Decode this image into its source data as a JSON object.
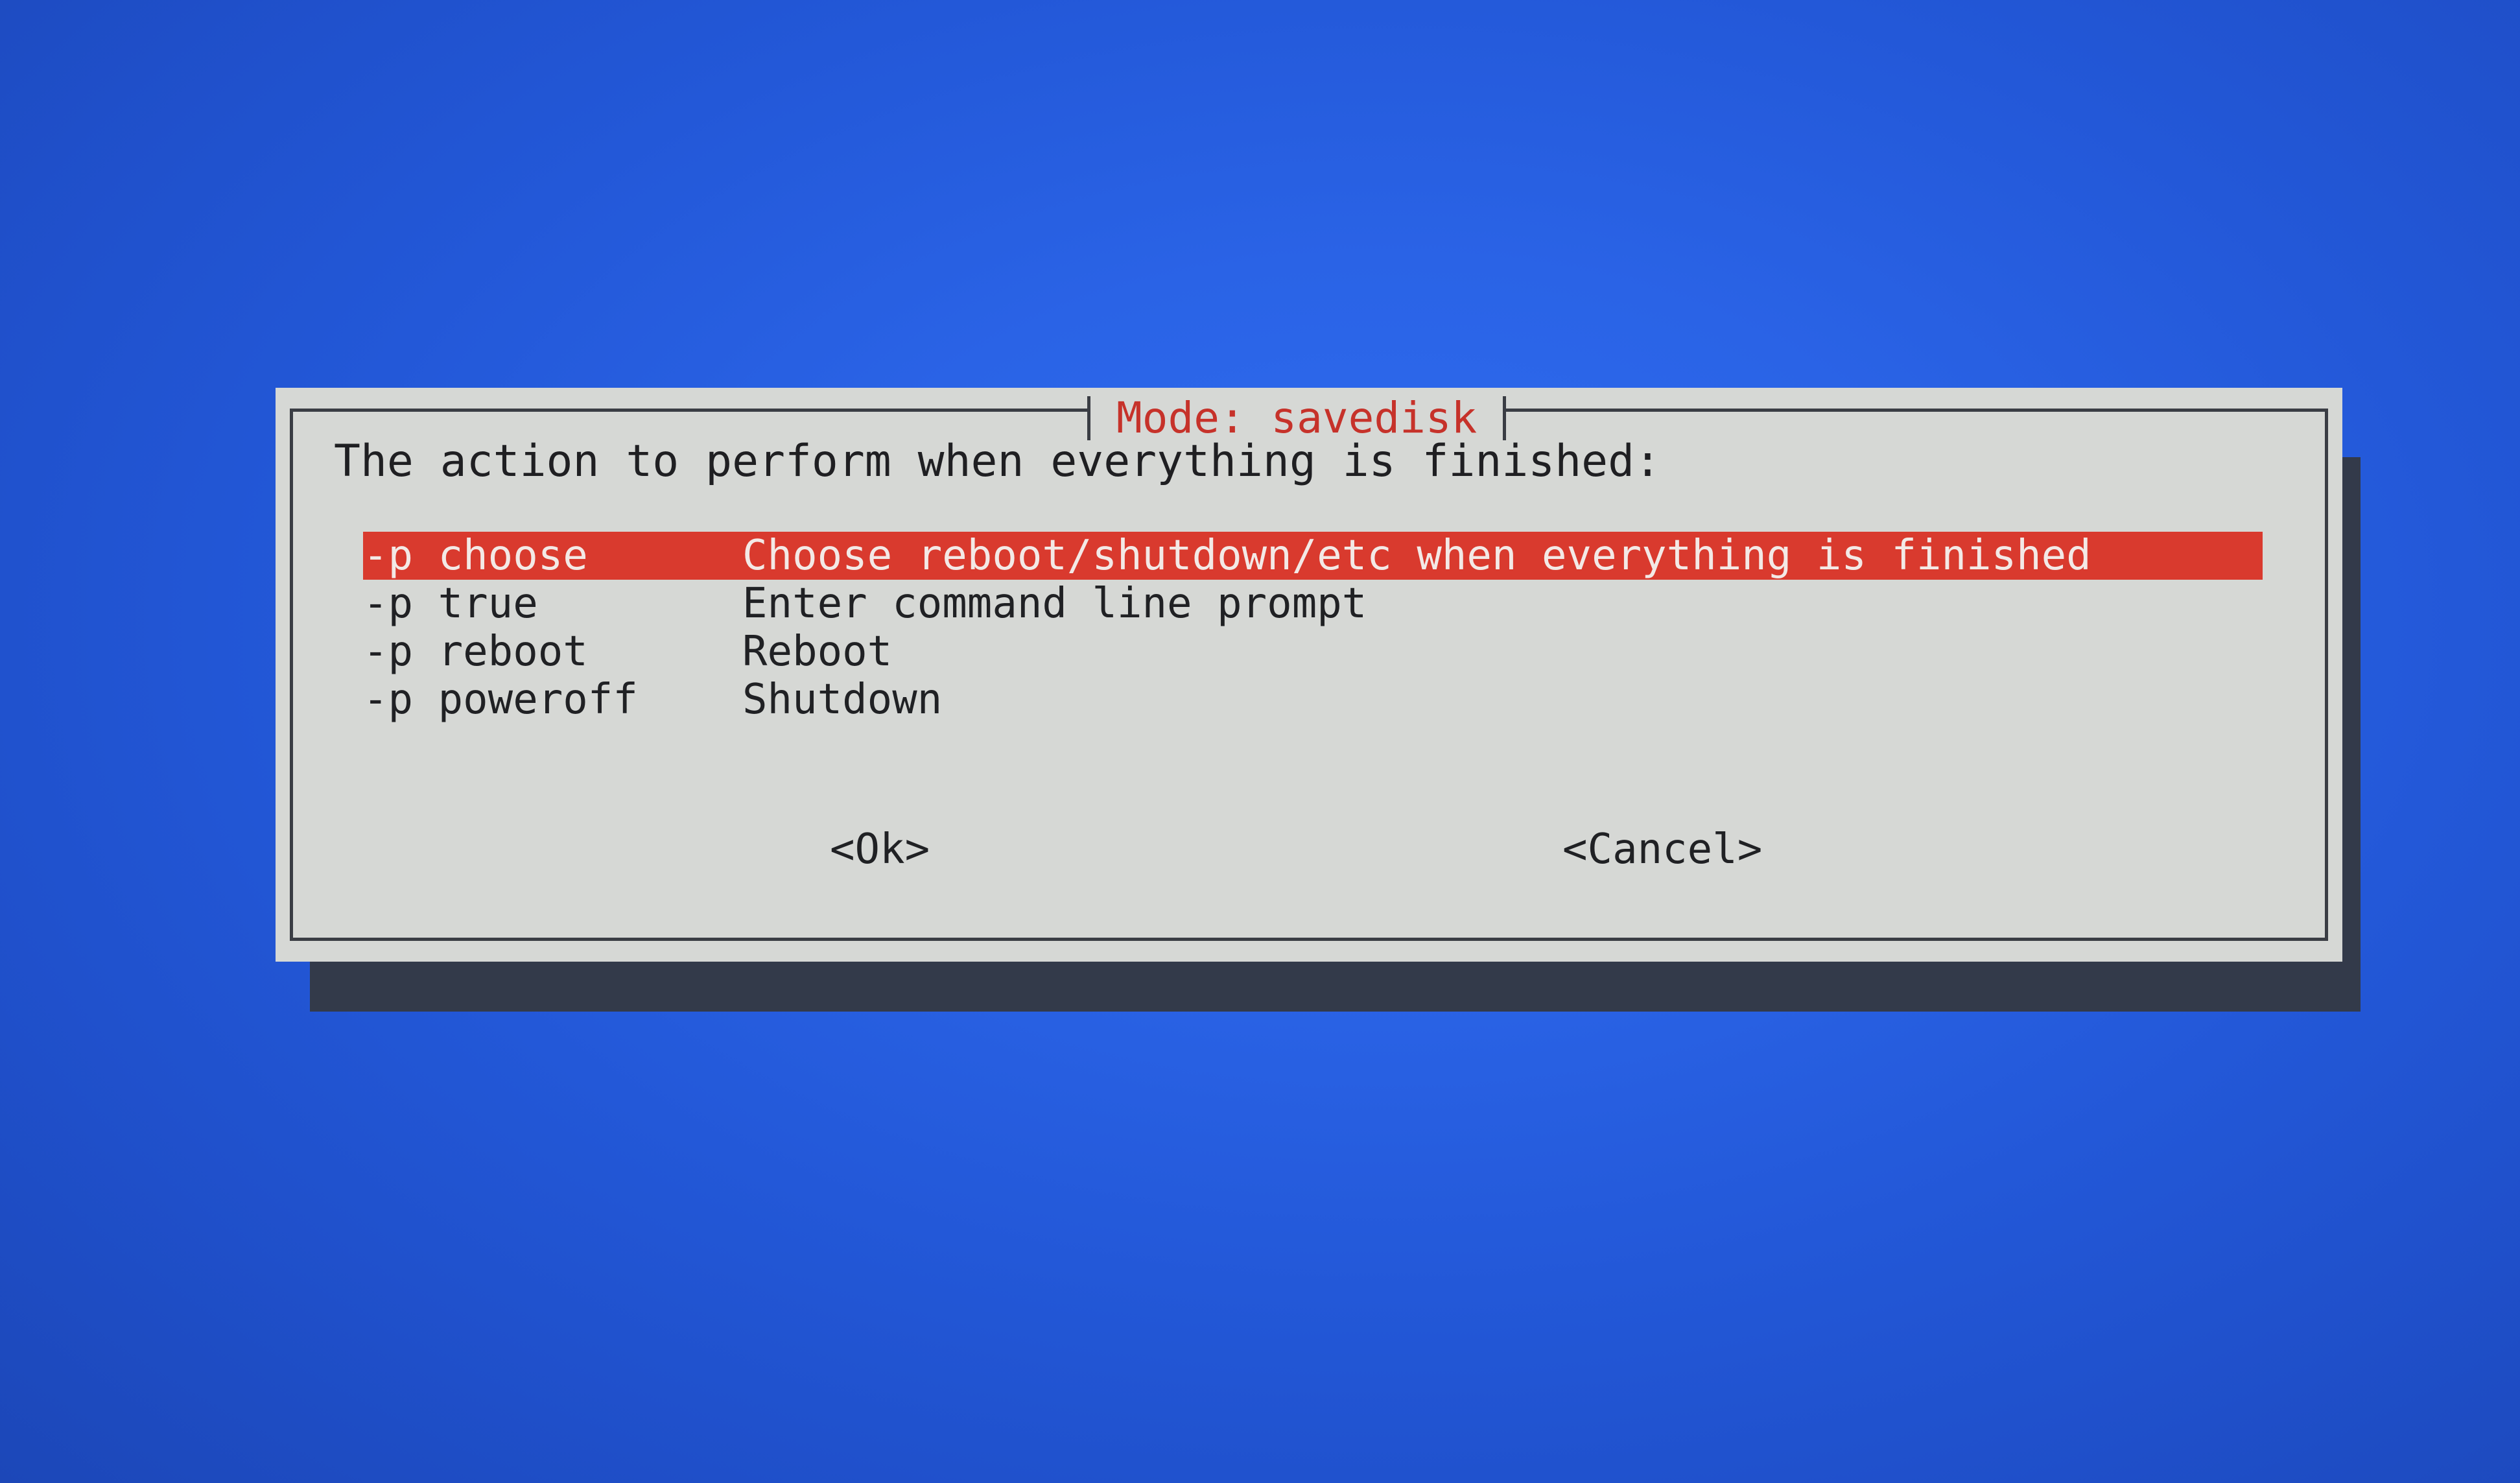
{
  "dialog": {
    "title": "Mode: savedisk",
    "prompt": "The action to perform when everything is finished:",
    "options": [
      {
        "tag": "-p choose",
        "description": "Choose reboot/shutdown/etc when everything is finished",
        "selected": true
      },
      {
        "tag": "-p true",
        "description": "Enter command line prompt",
        "selected": false
      },
      {
        "tag": "-p reboot",
        "description": "Reboot",
        "selected": false
      },
      {
        "tag": "-p poweroff",
        "description": "Shutdown",
        "selected": false
      }
    ],
    "ok_label": "<Ok>",
    "cancel_label": "<Cancel>"
  },
  "colors": {
    "background": "#2a63e6",
    "dialog": "#d6d8d5",
    "highlight": "#d93a2e",
    "title_text": "#c6322a"
  }
}
